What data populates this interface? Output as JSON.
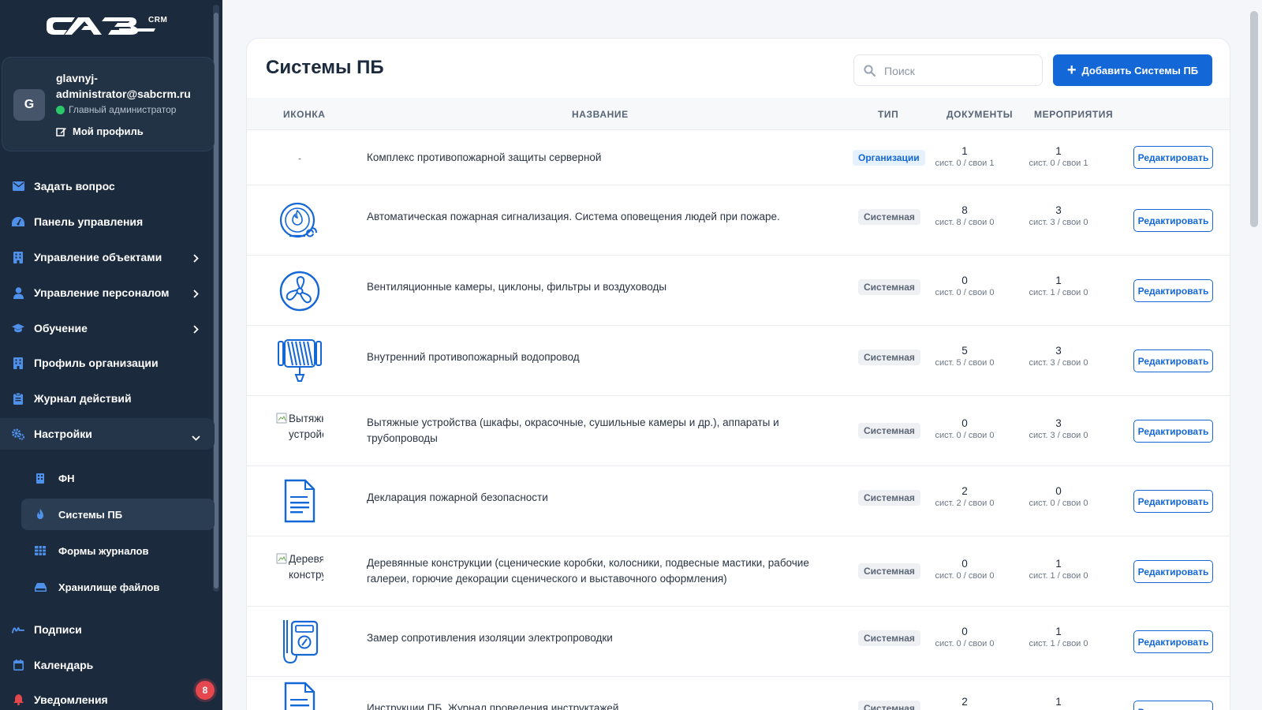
{
  "brand": {
    "logo_text": "CAB",
    "suffix": "CRM"
  },
  "profile": {
    "avatar_letter": "G",
    "name": "glavnyj-administrator@sabcrm.ru",
    "role": "Главный администратор",
    "profile_link": "Мой профиль"
  },
  "nav": {
    "ask": "Задать вопрос",
    "dashboard": "Панель управления",
    "objects": "Управление объектами",
    "personnel": "Управление персоналом",
    "training": "Обучение",
    "org_profile": "Профиль организации",
    "log": "Журнал действий",
    "settings": "Настройки",
    "sub_fn": "ФН",
    "sub_systems": "Системы ПБ",
    "sub_forms": "Формы журналов",
    "sub_storage": "Хранилище файлов",
    "signatures": "Подписи",
    "calendar": "Календарь",
    "notifications": "Уведомления",
    "notifications_count": "8"
  },
  "page": {
    "title": "Системы ПБ",
    "search_placeholder": "Поиск",
    "add_button": "Добавить Системы ПБ"
  },
  "table": {
    "headers": {
      "icon": "Иконка",
      "name": "Название",
      "type": "Тип",
      "docs": "Документы",
      "events": "Мероприятия"
    },
    "edit_label": "Редактировать",
    "rows": [
      {
        "icon": "-",
        "name": "Комплекс противопожарной защиты серверной",
        "type": "Организации",
        "docs": "1",
        "docs_sub": "сист. 0 / свои 1",
        "events": "1",
        "events_sub": "сист. 0 / свои 1"
      },
      {
        "icon": "fire-alarm-icon",
        "name": "Автоматическая пожарная сигнализация. Система оповещения людей при пожаре.",
        "type": "Системная",
        "docs": "8",
        "docs_sub": "сист. 8 / свои 0",
        "events": "3",
        "events_sub": "сист. 3 / свои 0"
      },
      {
        "icon": "fan-icon",
        "name": "Вентиляционные камеры, циклоны, фильтры и воздуховоды",
        "type": "Системная",
        "docs": "0",
        "docs_sub": "сист. 0 / свои 0",
        "events": "1",
        "events_sub": "сист. 1 / свои 0"
      },
      {
        "icon": "fire-hose-icon",
        "name": "Внутренний противопожарный водопровод",
        "type": "Системная",
        "docs": "5",
        "docs_sub": "сист. 5 / свои 0",
        "events": "3",
        "events_sub": "сист. 3 / свои 0"
      },
      {
        "icon": "broken-image-icon",
        "icon_alt": "Вытяжные устройст",
        "name": "Вытяжные устройства (шкафы, окрасочные, сушильные камеры и др.), аппараты и трубопроводы",
        "type": "Системная",
        "docs": "0",
        "docs_sub": "сист. 0 / свои 0",
        "events": "3",
        "events_sub": "сист. 3 / свои 0"
      },
      {
        "icon": "document-icon",
        "name": "Декларация пожарной безопасности",
        "type": "Системная",
        "docs": "2",
        "docs_sub": "сист. 2 / свои 0",
        "events": "0",
        "events_sub": "сист. 0 / свои 0"
      },
      {
        "icon": "broken-image-icon",
        "icon_alt": "Деревянные констру",
        "name": "Деревянные конструкции (сценические коробки, колосники, подвесные мастики, рабочие галереи, горючие декорации сценического и выставочного оформления)",
        "type": "Системная",
        "docs": "0",
        "docs_sub": "сист. 0 / свои 0",
        "events": "1",
        "events_sub": "сист. 1 / свои 0"
      },
      {
        "icon": "multimeter-icon",
        "name": "Замер сопротивления изоляции электропроводки",
        "type": "Системная",
        "docs": "0",
        "docs_sub": "сист. 0 / свои 0",
        "events": "1",
        "events_sub": "сист. 1 / свои 0"
      },
      {
        "icon": "document-icon",
        "name": "Инструкции ПБ. Журнал проведения инструктажей",
        "type": "Системная",
        "docs": "2",
        "docs_sub": "",
        "events": "1",
        "events_sub": ""
      }
    ]
  },
  "colors": {
    "sidebar": "#1b2a3d",
    "accent": "#1467d6",
    "badge": "#e5474f"
  }
}
